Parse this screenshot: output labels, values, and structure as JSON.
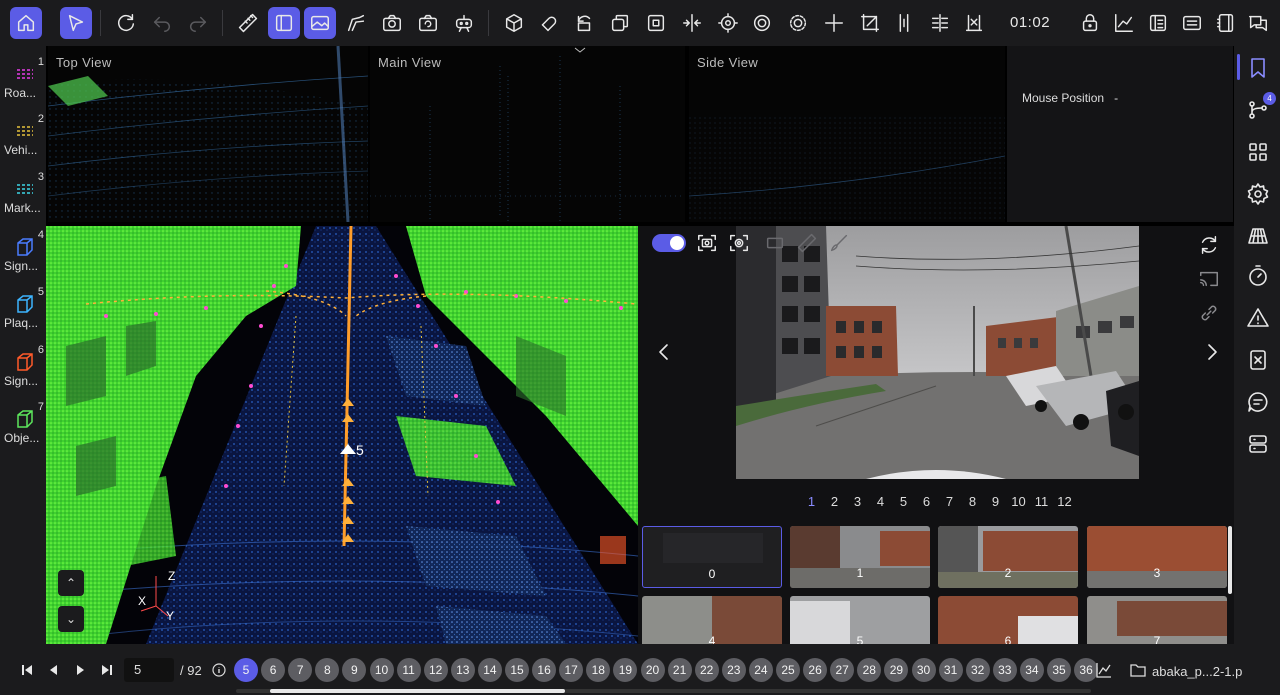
{
  "toolbar": {
    "clock": "01:02",
    "left_icons": [
      "home-icon",
      "select-arrow-icon",
      "refresh-icon",
      "undo-icon",
      "redo-icon",
      "ruler-icon",
      "panel-layout-icon",
      "image-icon",
      "path-icon",
      "camera-icon",
      "camera-rotate-icon",
      "robot-icon",
      "cube-3d-icon",
      "magnet-icon",
      "rotate-icon",
      "copy-icon",
      "square-icon",
      "compress-icon",
      "target-icon",
      "circle-settings-icon",
      "circle-gear-icon",
      "crosshair-icon",
      "crop-icon",
      "split-vertical-icon",
      "align-icon",
      "export-icon"
    ],
    "right_icons": [
      "lock-icon",
      "chart-icon",
      "list-icon",
      "subtitle-icon",
      "notebook-icon",
      "chat-icon"
    ]
  },
  "classes": [
    {
      "num": "1",
      "label": "Roa...",
      "color": "#e63ce6",
      "shape": "lines"
    },
    {
      "num": "2",
      "label": "Vehi...",
      "color": "#e6c23c",
      "shape": "lines"
    },
    {
      "num": "3",
      "label": "Mark...",
      "color": "#3cd6e6",
      "shape": "lines"
    },
    {
      "num": "4",
      "label": "Sign...",
      "color": "#4a7cff",
      "shape": "cube"
    },
    {
      "num": "5",
      "label": "Plaq...",
      "color": "#3cb4ff",
      "shape": "cube"
    },
    {
      "num": "6",
      "label": "Sign...",
      "color": "#ff5a2a",
      "shape": "cube"
    },
    {
      "num": "7",
      "label": "Obje...",
      "color": "#5ce65c",
      "shape": "cube"
    }
  ],
  "views": {
    "top": "Top View",
    "main": "Main View",
    "side": "Side View",
    "mouse_position_label": "Mouse Position",
    "mouse_position_value": "-"
  },
  "view3d": {
    "axis_z": "Z",
    "axis_x": "X",
    "axis_y": "Y",
    "selected_label": "5"
  },
  "image_panel": {
    "pages": [
      "1",
      "2",
      "3",
      "4",
      "5",
      "6",
      "7",
      "8",
      "9",
      "10",
      "11",
      "12"
    ],
    "current_page": "1",
    "thumbnails": [
      "0",
      "1",
      "2",
      "3",
      "4",
      "5",
      "6",
      "7"
    ]
  },
  "right_sidebar": {
    "badge": "4",
    "icons": [
      "bookmark-icon",
      "branch-icon",
      "grid-icon",
      "settings-icon",
      "perspective-icon",
      "timer-icon",
      "warning-icon",
      "close-doc-icon",
      "comment-icon",
      "database-icon"
    ]
  },
  "bottom": {
    "current_frame": "5",
    "total": "/ 92",
    "frames": [
      "5",
      "6",
      "7",
      "8",
      "9",
      "10",
      "11",
      "12",
      "13",
      "14",
      "15",
      "16",
      "17",
      "18",
      "19",
      "20",
      "21",
      "22",
      "23",
      "24",
      "25",
      "26",
      "27",
      "28",
      "29",
      "30",
      "31",
      "32",
      "33",
      "34",
      "35",
      "36"
    ],
    "filename": "abaka_p...2-1.p"
  }
}
